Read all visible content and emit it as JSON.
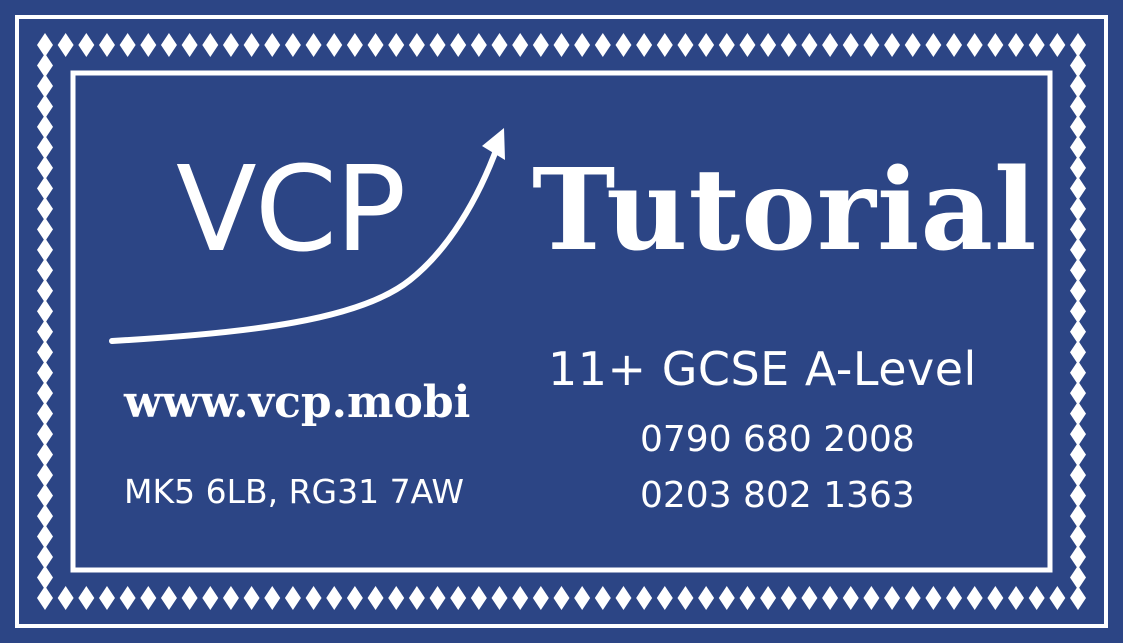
{
  "logo": {
    "brand": "VCP",
    "name": "Tutorial",
    "arrow_icon": "growth-arrow-icon"
  },
  "offer": {
    "subjects": "11+ GCSE A-Level"
  },
  "contact": {
    "website": "www.vcp.mobi",
    "postcodes": "MK5 6LB, RG31 7AW",
    "phone_1": "0790 680 2008",
    "phone_2": "0203 802 1363"
  },
  "colors": {
    "background": "#2c4585",
    "foreground": "#ffffff"
  }
}
